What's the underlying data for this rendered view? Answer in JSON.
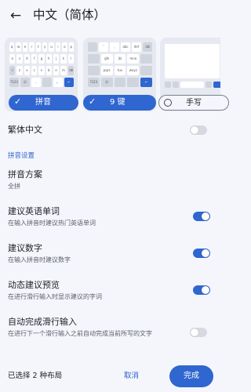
{
  "appbar": {
    "title": "中文（简体）",
    "back_icon": "arrow-left-icon"
  },
  "layouts": [
    {
      "name": "拼音",
      "selected": true,
      "rows": [
        [
          "q",
          "w",
          "e",
          "r",
          "t",
          "y",
          "u",
          "i",
          "o",
          "p"
        ],
        [
          "a",
          "s",
          "d",
          "f",
          "g",
          "h",
          "j",
          "k",
          "l"
        ],
        [
          "⇧",
          "z",
          "x",
          "c",
          "v",
          "b",
          "n",
          "m",
          "⌫"
        ],
        [
          "?123",
          "☺",
          ",",
          "",
          "。",
          "↵"
        ]
      ]
    },
    {
      "name": "9 键",
      "selected": true,
      "rows": [
        [
          "",
          "'",
          ",",
          "abc",
          "def",
          "⌫"
        ],
        [
          "",
          "ghi",
          "jkl",
          "mno",
          ""
        ],
        [
          "",
          "pqrs",
          "tuv",
          "wxyz",
          ""
        ],
        [
          "?123",
          "☺",
          "",
          "",
          "↵"
        ]
      ]
    },
    {
      "name": "手写",
      "selected": false
    }
  ],
  "settings": {
    "traditional": {
      "title": "繁体中文",
      "on": false
    },
    "section_pinyin": "拼音设置",
    "scheme": {
      "title": "拼音方案",
      "value": "全拼"
    },
    "suggest_english": {
      "title": "建议英语单词",
      "desc": "在输入拼音时建议热门英语单词",
      "on": true
    },
    "suggest_numbers": {
      "title": "建议数字",
      "desc": "在输入拼音时建议数字",
      "on": true
    },
    "dynamic_preview": {
      "title": "动态建议预览",
      "desc": "在进行滑行输入时显示建议的字词",
      "on": true
    },
    "auto_complete": {
      "title": "自动完成滑行输入",
      "desc": "在进行下一个滑行输入之前自动完成当前所写的文字",
      "on": false
    }
  },
  "footer": {
    "selected_text": "已选择 2 种布局",
    "cancel_label": "取消",
    "done_label": "完成"
  },
  "colors": {
    "accent": "#2f66d0",
    "background": "#f4f6fb"
  }
}
